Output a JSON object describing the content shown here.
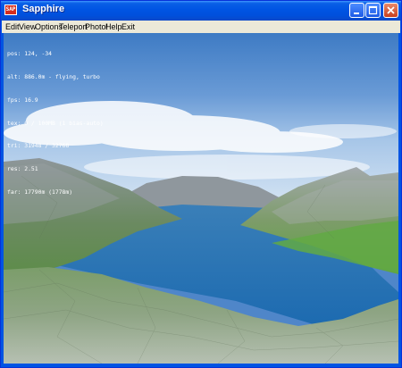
{
  "window": {
    "title": "Sapphire",
    "icon_name": "app-logo-icon",
    "icon_text": "SAP",
    "controls": [
      "minimize-icon",
      "maximize-icon",
      "close-icon"
    ]
  },
  "menu": {
    "items": [
      "Edit",
      "View",
      "Options",
      "Teleport",
      "Photo!",
      "Help",
      "Exit"
    ]
  },
  "hud": {
    "lines": [
      "pos: 124, -34",
      "alt: 886.0m - flying, turbo",
      "fps: 16.9",
      "tex: 0 / 100MB (1 bias-auto)",
      "tri: 31948 / 32768",
      "res: 2.51",
      "far: 17790m (1778m)"
    ]
  },
  "colors": {
    "sky_top": "#3e7bc4",
    "sky_horizon": "#c8dcf0",
    "water": "#1f6fb5",
    "grass": "#6aa64a"
  }
}
